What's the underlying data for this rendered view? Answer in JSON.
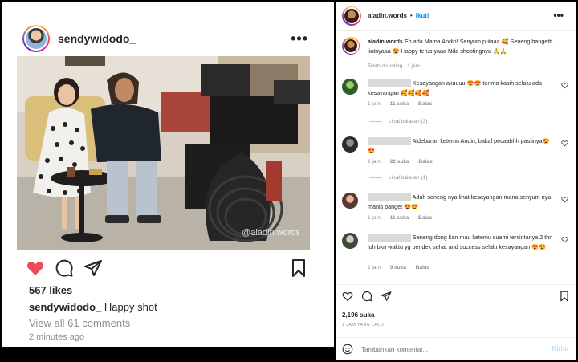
{
  "post": {
    "username": "sendywidodo_",
    "likes": "567 likes",
    "caption_user": "sendywidodo_",
    "caption_text": "Happy shot",
    "view_comments": "View all 61 comments",
    "time_ago": "2 minutes ago",
    "watermark": "@aladin.words"
  },
  "side": {
    "username": "aladin.words",
    "separator": "•",
    "follow": "Ikuti",
    "caption_user": "aladin.words",
    "caption_text": "Eh ada Mama Andin! Senyum pulaaa 🥰 Seneng bangettt liatnyaaa 😍 Happy terus yaaa Nda shootingnya 🙏🙏",
    "caption_meta": "Telah disunting · 1 jam",
    "comments": [
      {
        "text": "Kesayangan akuuuu 😍😍 terima kasih selalu ada kesayangan 🥰🥰🥰🥰",
        "time": "1 jam",
        "likes": "11 suka",
        "reply": "Balas",
        "view_replies": "Lihat balasan (3)"
      },
      {
        "text": "Aldebaran ketemu Andin, bakal pecaahhh pastinya😍😍",
        "time": "1 jam",
        "likes": "22 suka",
        "reply": "Balas",
        "view_replies": "Lihat balasan (1)"
      },
      {
        "text": "Aduh seneng nya lihat kesayangan mana senyum nya manis banget 😍😍",
        "time": "1 jam",
        "likes": "11 suka",
        "reply": "Balas"
      },
      {
        "text": "Seneng dong kan mau ketemu suami tercintanya 2 thn loh bkn waktu yg pendek sehat and success selalu kesayangan 😍😍",
        "time": "1 jam",
        "likes": "9 suka",
        "reply": "Balas"
      }
    ],
    "likes": "2,196 suka",
    "time": "1 JAM YANG LALU",
    "comment_placeholder": "Tambahkan komentar...",
    "send": "Kirim"
  },
  "colors": {
    "like_red": "#ed4956",
    "link_blue": "#0095f6"
  }
}
